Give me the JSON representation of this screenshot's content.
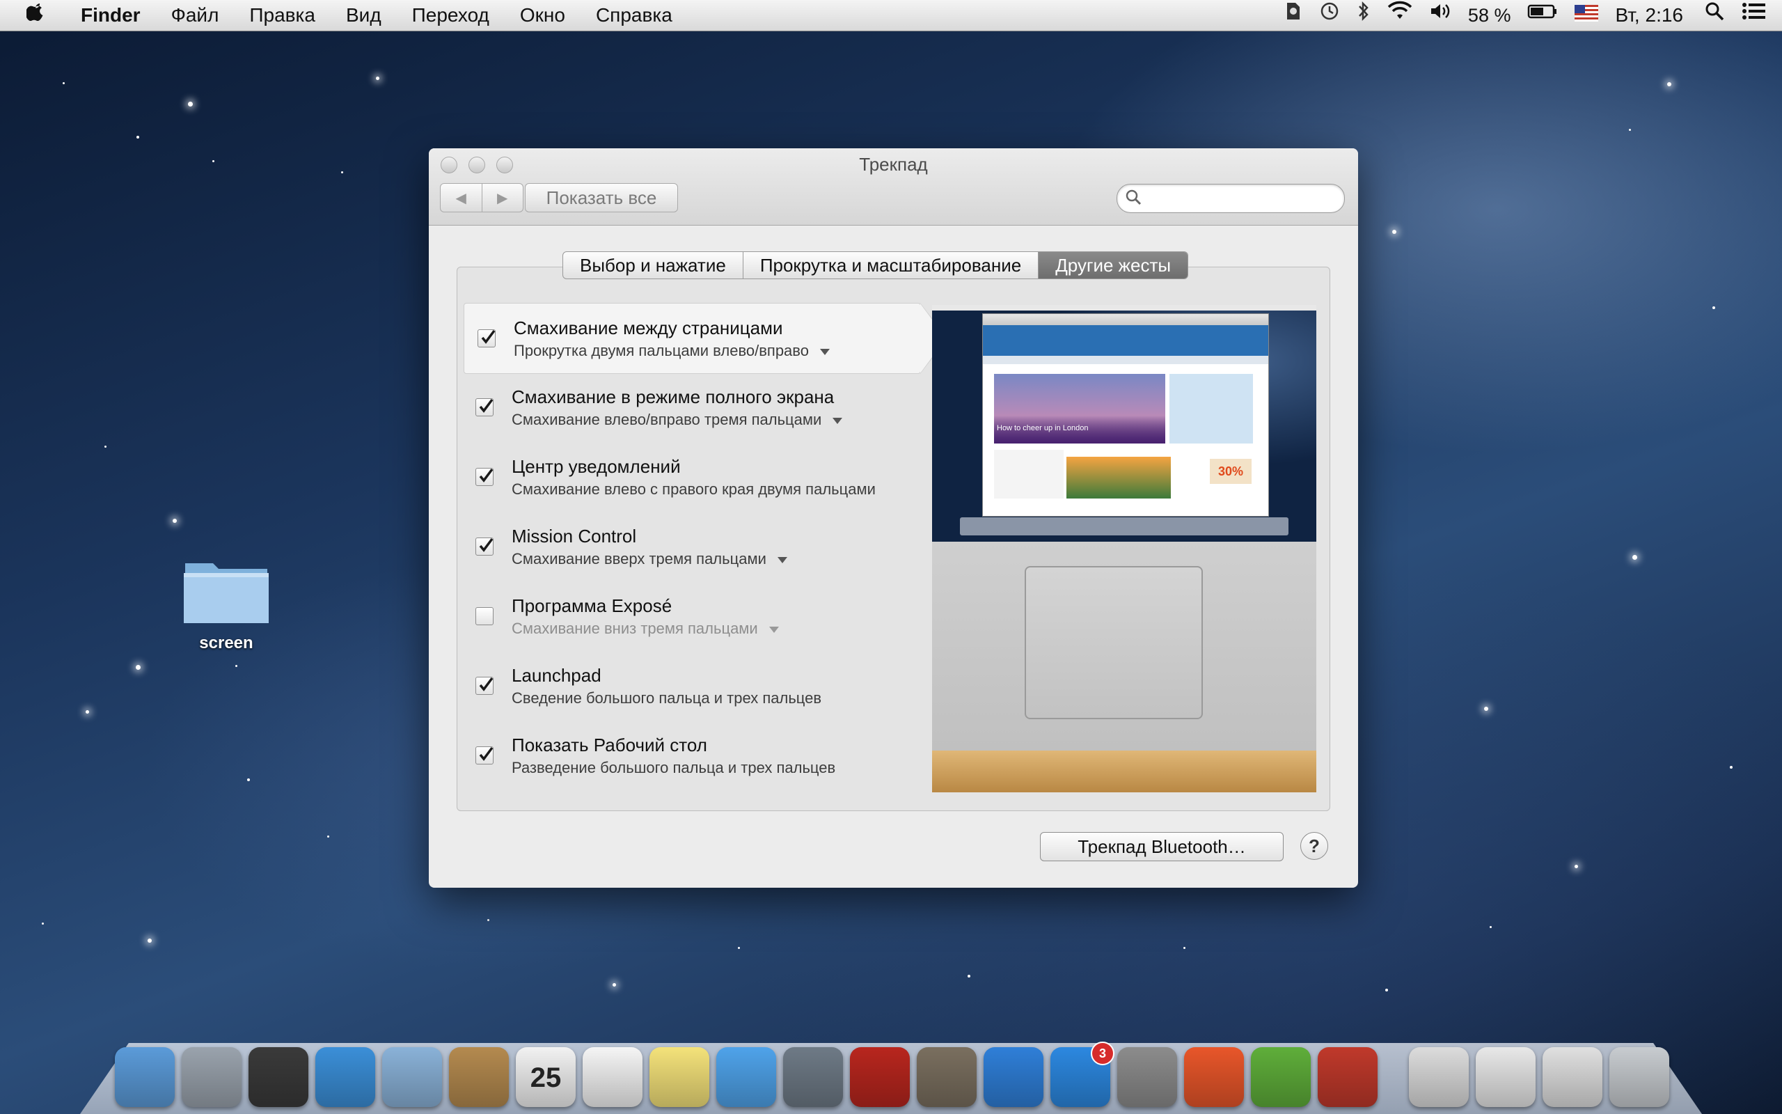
{
  "menubar": {
    "app_name": "Finder",
    "menus": [
      "Файл",
      "Правка",
      "Вид",
      "Переход",
      "Окно",
      "Справка"
    ],
    "battery": "58 %",
    "clock": "Вт, 2:16",
    "icons": [
      "evernote-icon",
      "time-machine-icon",
      "bluetooth-icon",
      "wifi-icon",
      "volume-icon",
      "battery-icon",
      "flag-us-icon",
      "spotlight-icon",
      "notification-center-icon"
    ]
  },
  "desktop": {
    "folder_label": "screen"
  },
  "window": {
    "title": "Трекпад",
    "show_all": "Показать все",
    "search_placeholder": "",
    "tabs": [
      {
        "label": "Выбор и нажатие",
        "selected": false
      },
      {
        "label": "Прокрутка и масштабирование",
        "selected": false
      },
      {
        "label": "Другие жесты",
        "selected": true
      }
    ],
    "gestures": [
      {
        "title": "Смахивание между страницами",
        "subtitle": "Прокрутка двумя пальцами влево/вправо",
        "checked": true,
        "has_popup": true,
        "selected": true
      },
      {
        "title": "Смахивание в режиме полного экрана",
        "subtitle": "Смахивание влево/вправо тремя пальцами",
        "checked": true,
        "has_popup": true,
        "selected": false
      },
      {
        "title": "Центр уведомлений",
        "subtitle": "Смахивание влево с правого края двумя пальцами",
        "checked": true,
        "has_popup": false,
        "selected": false
      },
      {
        "title": "Mission Control",
        "subtitle": "Смахивание вверх тремя пальцами",
        "checked": true,
        "has_popup": true,
        "selected": false
      },
      {
        "title": "Программа Exposé",
        "subtitle": "Смахивание вниз тремя пальцами",
        "checked": false,
        "has_popup": true,
        "selected": false
      },
      {
        "title": "Launchpad",
        "subtitle": "Сведение большого пальца и трех пальцев",
        "checked": true,
        "has_popup": false,
        "selected": false
      },
      {
        "title": "Показать Рабочий стол",
        "subtitle": "Разведение большого пальца и трех пальцев",
        "checked": true,
        "has_popup": false,
        "selected": false
      }
    ],
    "preview": {
      "headline": "How to cheer up in London",
      "ad_text": "30%"
    },
    "bluetooth_button": "Трекпад Bluetooth…",
    "help_button": "?"
  },
  "dock": {
    "items": [
      {
        "name": "finder-icon",
        "color": "#5b9bd9"
      },
      {
        "name": "launchpad-icon",
        "color": "#9aa3ad"
      },
      {
        "name": "mission-control-icon",
        "color": "#3a3a3a"
      },
      {
        "name": "safari-icon",
        "color": "#3b8fd8"
      },
      {
        "name": "mail-icon",
        "color": "#8ab2d8"
      },
      {
        "name": "contacts-icon",
        "color": "#b48a4f"
      },
      {
        "name": "calendar-icon",
        "color": "#f2f2f2",
        "text": "25"
      },
      {
        "name": "reminders-icon",
        "color": "#f5f5f5"
      },
      {
        "name": "notes-icon",
        "color": "#f4e27a"
      },
      {
        "name": "messages-icon",
        "color": "#4fa3ea"
      },
      {
        "name": "facetime-icon",
        "color": "#6e7a86"
      },
      {
        "name": "photo-booth-icon",
        "color": "#b8261e"
      },
      {
        "name": "iphoto-icon",
        "color": "#7a6f5f"
      },
      {
        "name": "itunes-icon",
        "color": "#2f7fd8"
      },
      {
        "name": "app-store-icon",
        "color": "#2c88e0",
        "badge": "3"
      },
      {
        "name": "system-preferences-icon",
        "color": "#8c8c8c"
      },
      {
        "name": "wunderlist-icon",
        "color": "#e8562a"
      },
      {
        "name": "evernote-icon",
        "color": "#5fae3a"
      },
      {
        "name": "angry-birds-seasons-icon",
        "color": "#c0392b"
      },
      {
        "name": "documents-stack-icon",
        "color": "#dcdcdc"
      },
      {
        "name": "downloads-stack-icon",
        "color": "#e8e8e8"
      },
      {
        "name": "applications-stack-icon",
        "color": "#e0e0e0"
      },
      {
        "name": "trash-icon",
        "color": "#c8ccd0"
      }
    ]
  }
}
